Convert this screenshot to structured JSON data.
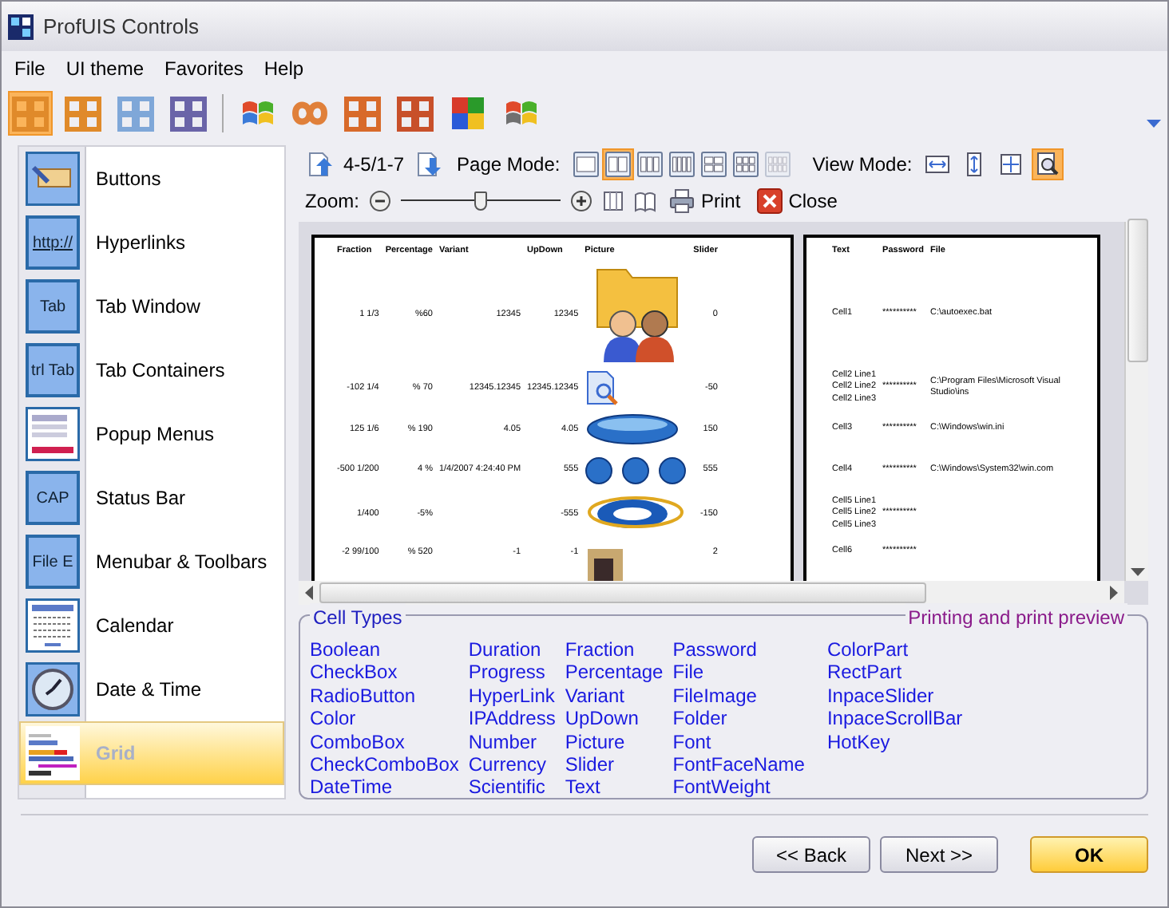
{
  "window": {
    "title": "ProfUIS Controls"
  },
  "menu": [
    {
      "label": "File"
    },
    {
      "label": "UI theme"
    },
    {
      "label": "Favorites"
    },
    {
      "label": "Help"
    }
  ],
  "theme_toolbar": [
    {
      "kind": "grid",
      "color": "#e08a2a",
      "selected": true
    },
    {
      "kind": "grid",
      "color": "#e08a2a",
      "selected": false
    },
    {
      "kind": "grid",
      "color": "#7fa7d8",
      "selected": false
    },
    {
      "kind": "grid",
      "color": "#6a64a8",
      "selected": false
    },
    {
      "kind": "flag",
      "color": "#3a7ad8",
      "selected": false
    },
    {
      "kind": "infinity",
      "color": "#e0803a",
      "selected": false
    },
    {
      "kind": "grid",
      "color": "#d86a2a",
      "selected": false
    },
    {
      "kind": "grid",
      "color": "#c8502a",
      "selected": false
    },
    {
      "kind": "puzzle",
      "color": "#d83a2a",
      "selected": false
    },
    {
      "kind": "flag",
      "color": "#707070",
      "selected": false
    }
  ],
  "sidebar": {
    "items": [
      {
        "label": "Buttons",
        "kind": "button",
        "selected": false
      },
      {
        "label": "Hyperlinks",
        "kind": "link",
        "icon_text": "http://",
        "selected": false
      },
      {
        "label": "Tab Window",
        "kind": "tab",
        "icon_text": "Tab",
        "selected": false
      },
      {
        "label": "Tab Containers",
        "kind": "tab",
        "icon_text": "trl Tab",
        "selected": false
      },
      {
        "label": "Popup Menus",
        "kind": "menu",
        "selected": false
      },
      {
        "label": "Status Bar",
        "kind": "tab",
        "icon_text": "CAP",
        "selected": false
      },
      {
        "label": "Menubar & Toolbars",
        "kind": "tab",
        "icon_text": "File E",
        "selected": false
      },
      {
        "label": "Calendar",
        "kind": "calendar",
        "selected": false
      },
      {
        "label": "Date & Time",
        "kind": "clock",
        "selected": false
      },
      {
        "label": "Grid",
        "kind": "grid",
        "selected": true
      }
    ]
  },
  "preview_toolbar": {
    "page_range": "4-5/1-7",
    "page_mode_label": "Page Mode:",
    "page_modes": [
      {
        "kind": "one",
        "selected": false,
        "disabled": false
      },
      {
        "kind": "two",
        "selected": true,
        "disabled": false
      },
      {
        "kind": "three",
        "selected": false,
        "disabled": false
      },
      {
        "kind": "four",
        "selected": false,
        "disabled": false
      },
      {
        "kind": "grid4",
        "selected": false,
        "disabled": false
      },
      {
        "kind": "grid6",
        "selected": false,
        "disabled": false
      },
      {
        "kind": "grid8",
        "selected": false,
        "disabled": true
      }
    ],
    "view_mode_label": "View Mode:",
    "view_modes": [
      {
        "kind": "width",
        "selected": false
      },
      {
        "kind": "height",
        "selected": false
      },
      {
        "kind": "both",
        "selected": false
      },
      {
        "kind": "zoom",
        "selected": true
      }
    ],
    "zoom_label": "Zoom:",
    "zoom": {
      "level": 0.5
    },
    "print": "Print",
    "close": "Close"
  },
  "pages": [
    {
      "columns": [
        "Fraction",
        "Percentage",
        "Variant",
        "UpDown",
        "Picture",
        "Slider"
      ],
      "rows": [
        {
          "cells": [
            "1  1/3",
            "%60",
            "12345",
            "12345",
            "",
            "0"
          ],
          "kind": "folder"
        },
        {
          "cells": [
            "-102  1/4",
            "% 70",
            "12345.12345",
            "12345.12345",
            "",
            "-50"
          ],
          "kind": "document"
        },
        {
          "cells": [
            "125  1/6",
            "% 190",
            "4.05",
            "4.05",
            "",
            "150"
          ],
          "kind": "oval"
        },
        {
          "cells": [
            "-500  1/200",
            "4 %",
            "1/4/2007 4:24:40 PM",
            "555",
            "",
            "555"
          ],
          "kind": "circles"
        },
        {
          "cells": [
            "1/400",
            "-5%",
            "",
            "-555",
            "",
            "-150"
          ],
          "kind": "ring"
        },
        {
          "cells": [
            "-2  99/100",
            "% 520",
            "-1",
            "-1",
            "",
            "2"
          ],
          "kind": "photo"
        }
      ]
    },
    {
      "columns": [
        "Text",
        "Password",
        "File"
      ],
      "rows": [
        {
          "cells": [
            "Cell1",
            "**********",
            "C:\\autoexec.bat"
          ]
        },
        {
          "cells": [
            "Cell2 Line1\nCell2 Line2\nCell2 Line3",
            "**********",
            "C:\\Program Files\\Microsoft Visual Studio\\ins"
          ]
        },
        {
          "cells": [
            "Cell3",
            "**********",
            "C:\\Windows\\win.ini"
          ]
        },
        {
          "cells": [
            "Cell4",
            "**********",
            "C:\\Windows\\System32\\win.com"
          ]
        },
        {
          "cells": [
            "Cell5 Line1\nCell5 Line2\nCell5 Line3",
            "**********",
            ""
          ]
        },
        {
          "cells": [
            "Cell6",
            "**********",
            ""
          ]
        }
      ]
    }
  ],
  "cell_types": {
    "title": "Cell Types",
    "caption": "Printing and print preview",
    "columns": [
      [
        "Boolean",
        "CheckBox",
        "RadioButton",
        "Color",
        "ComboBox",
        "CheckComboBox",
        "DateTime"
      ],
      [
        "Duration",
        "Progress",
        "HyperLink",
        "IPAddress",
        "Number",
        "Currency",
        "Scientific"
      ],
      [
        "Fraction",
        "Percentage",
        "Variant",
        "UpDown",
        "Picture",
        "Slider",
        "Text"
      ],
      [
        "Password",
        "File",
        "FileImage",
        "Folder",
        "Font",
        "FontFaceName",
        "FontWeight"
      ],
      [
        "ColorPart",
        "RectPart",
        "InpaceSlider",
        "InpaceScrollBar",
        "HotKey"
      ]
    ]
  },
  "buttons": [
    {
      "label": "<< Back",
      "default": false
    },
    {
      "label": "Next >>",
      "default": false
    },
    {
      "label": "OK",
      "default": true
    }
  ]
}
